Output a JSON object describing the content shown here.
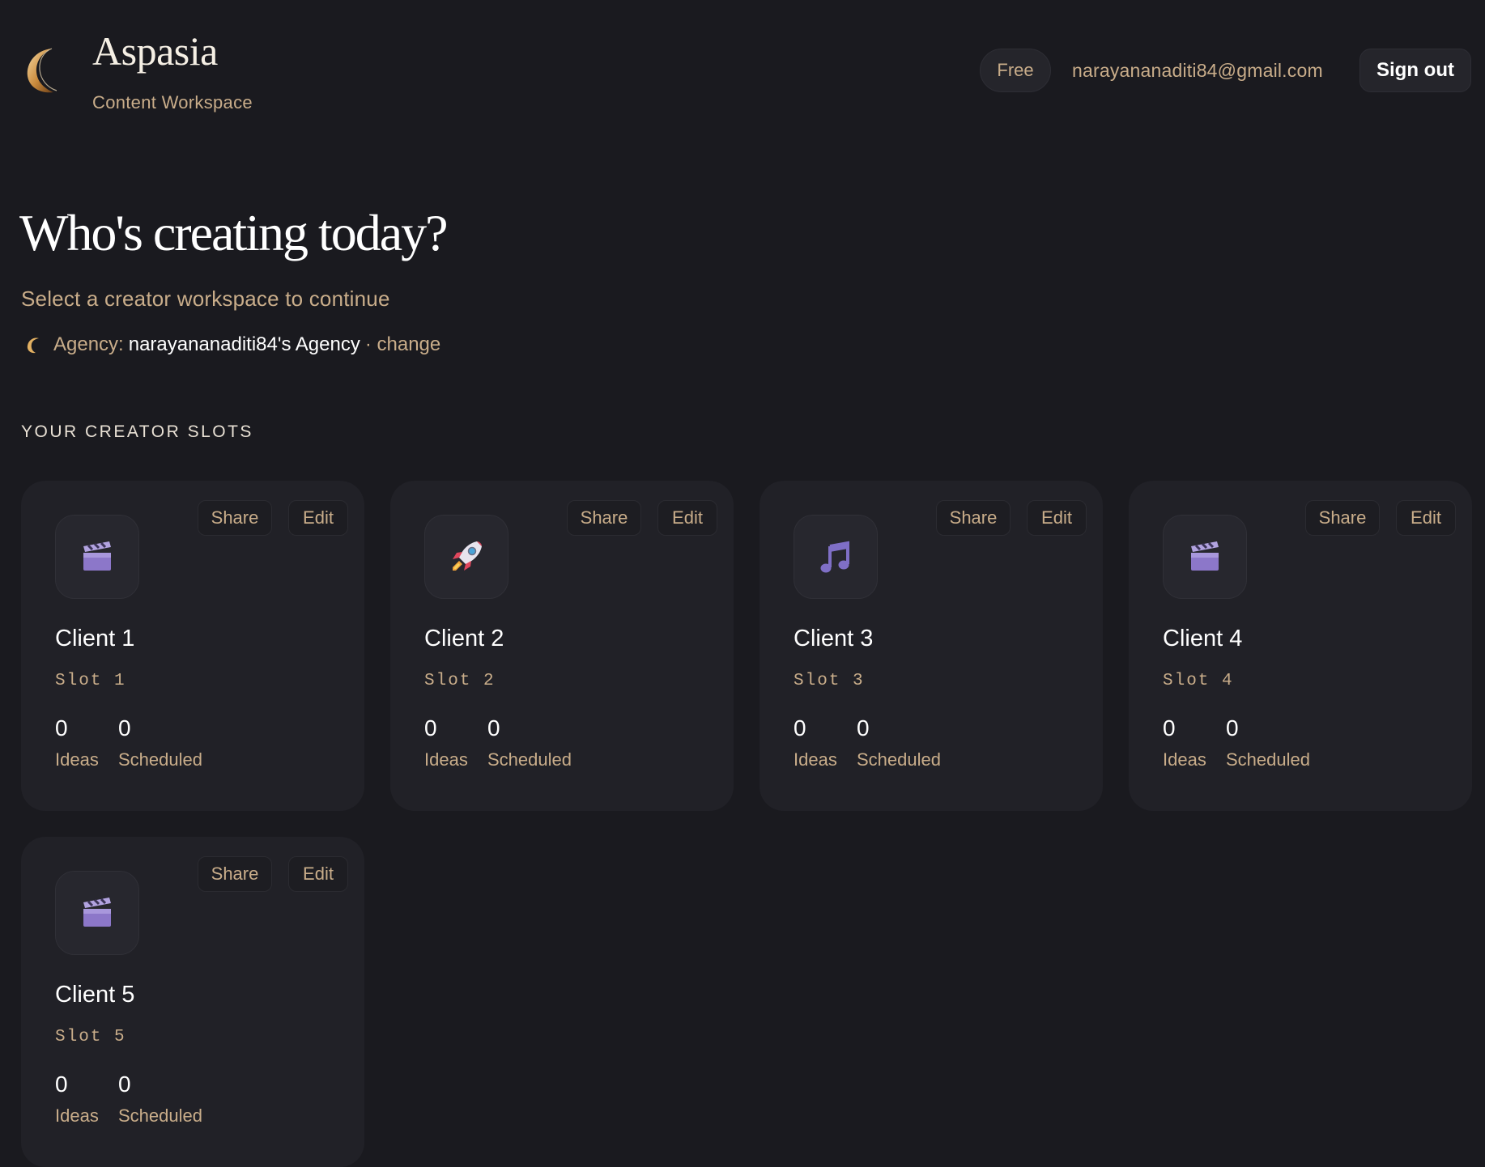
{
  "header": {
    "brand_name": "Aspasia",
    "brand_subtitle": "Content Workspace",
    "plan_badge": "Free",
    "user_email": "narayananaditi84@gmail.com",
    "signout_label": "Sign out"
  },
  "main": {
    "title": "Who's creating today?",
    "subtitle": "Select a creator workspace to continue",
    "agency": {
      "label": "Agency:",
      "name": "narayananaditi84's Agency",
      "change_label": "· change"
    },
    "section_label": "YOUR CREATOR SLOTS",
    "cards": [
      {
        "name": "Client 1",
        "slot": "Slot 1",
        "icon": "clapperboard-icon",
        "ideas": "0",
        "ideas_label": "Ideas",
        "scheduled": "0",
        "scheduled_label": "Scheduled",
        "share_label": "Share",
        "edit_label": "Edit"
      },
      {
        "name": "Client 2",
        "slot": "Slot 2",
        "icon": "rocket-icon",
        "ideas": "0",
        "ideas_label": "Ideas",
        "scheduled": "0",
        "scheduled_label": "Scheduled",
        "share_label": "Share",
        "edit_label": "Edit"
      },
      {
        "name": "Client 3",
        "slot": "Slot 3",
        "icon": "music-note-icon",
        "ideas": "0",
        "ideas_label": "Ideas",
        "scheduled": "0",
        "scheduled_label": "Scheduled",
        "share_label": "Share",
        "edit_label": "Edit"
      },
      {
        "name": "Client 4",
        "slot": "Slot 4",
        "icon": "clapperboard-icon",
        "ideas": "0",
        "ideas_label": "Ideas",
        "scheduled": "0",
        "scheduled_label": "Scheduled",
        "share_label": "Share",
        "edit_label": "Edit"
      },
      {
        "name": "Client 5",
        "slot": "Slot 5",
        "icon": "clapperboard-icon",
        "ideas": "0",
        "ideas_label": "Ideas",
        "scheduled": "0",
        "scheduled_label": "Scheduled",
        "share_label": "Share",
        "edit_label": "Edit"
      }
    ]
  },
  "colors": {
    "background": "#1a1a1f",
    "card": "#212127",
    "accent_text": "#c9ad8a",
    "primary_text": "#ffffff",
    "moon_gold": "#e2b062"
  }
}
